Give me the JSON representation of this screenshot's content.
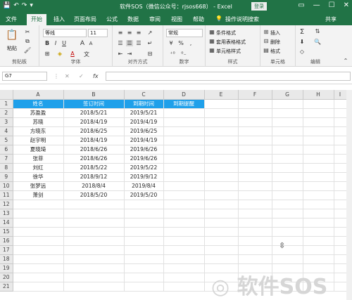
{
  "window": {
    "title": "软件SOS（微信公众号：rjsos668）  -  Excel",
    "login_label": "登录",
    "share_label": "共享",
    "qa_save": "💾",
    "qa_undo": "↶",
    "qa_redo": "↷",
    "qa_more": "▾",
    "wc_restore": "▭",
    "wc_min": "—",
    "wc_max": "☐",
    "wc_close": "✕"
  },
  "tabs": [
    "文件",
    "开始",
    "插入",
    "页面布局",
    "公式",
    "数据",
    "审阅",
    "视图",
    "帮助"
  ],
  "tell_me": "操作说明搜索",
  "ribbon": {
    "clipboard": {
      "label": "剪贴板",
      "paste": "粘贴"
    },
    "font": {
      "label": "字体",
      "name": "等线",
      "size": "11",
      "bold": "B",
      "italic": "I",
      "underline": "U",
      "grow": "A",
      "shrink": "A",
      "color_a": "A",
      "wen": "文"
    },
    "align": {
      "label": "对齐方式"
    },
    "number": {
      "label": "数字",
      "format": "常规",
      "currency": "¥",
      "percent": "%",
      "comma": ","
    },
    "styles": {
      "label": "样式",
      "cond": "条件格式",
      "table": "套用表格格式",
      "cell": "单元格样式"
    },
    "cells": {
      "label": "单元格",
      "insert": "插入",
      "delete": "删除",
      "format": "格式"
    },
    "edit": {
      "label": "编辑",
      "sum": "Σ"
    }
  },
  "formula_bar": {
    "name_box": "G7",
    "cancel": "✕",
    "confirm": "✓",
    "fx": "fx",
    "value": ""
  },
  "columns": [
    "A",
    "B",
    "C",
    "D",
    "E",
    "F",
    "G",
    "H",
    "I"
  ],
  "header_row": [
    "姓名",
    "签订时间",
    "到期时间",
    "到期提醒"
  ],
  "rows": [
    [
      "苏盈盈",
      "2018/5/21",
      "2019/5/21",
      ""
    ],
    [
      "苏晓",
      "2018/4/19",
      "2019/4/19",
      ""
    ],
    [
      "方晓东",
      "2018/6/25",
      "2019/6/25",
      ""
    ],
    [
      "赵宇明",
      "2018/4/19",
      "2019/4/19",
      ""
    ],
    [
      "夏晓琦",
      "2018/6/26",
      "2019/6/26",
      ""
    ],
    [
      "张菲",
      "2018/6/26",
      "2019/6/26",
      ""
    ],
    [
      "刘红",
      "2018/5/22",
      "2019/5/22",
      ""
    ],
    [
      "徐华",
      "2018/9/12",
      "2019/9/12",
      ""
    ],
    [
      "张梦远",
      "2018/8/4",
      "2019/8/4",
      ""
    ],
    [
      "萧剑",
      "2018/5/20",
      "2019/5/20",
      ""
    ]
  ],
  "row_numbers": [
    "1",
    "2",
    "3",
    "4",
    "5",
    "6",
    "7",
    "8",
    "9",
    "10",
    "11",
    "12",
    "13",
    "14",
    "15",
    "16",
    "17",
    "18",
    "19",
    "20",
    "21"
  ],
  "accent_color": "#217346",
  "header_fill": "#1fa0ea",
  "cursor": "⇳",
  "watermark": "软件SOS"
}
